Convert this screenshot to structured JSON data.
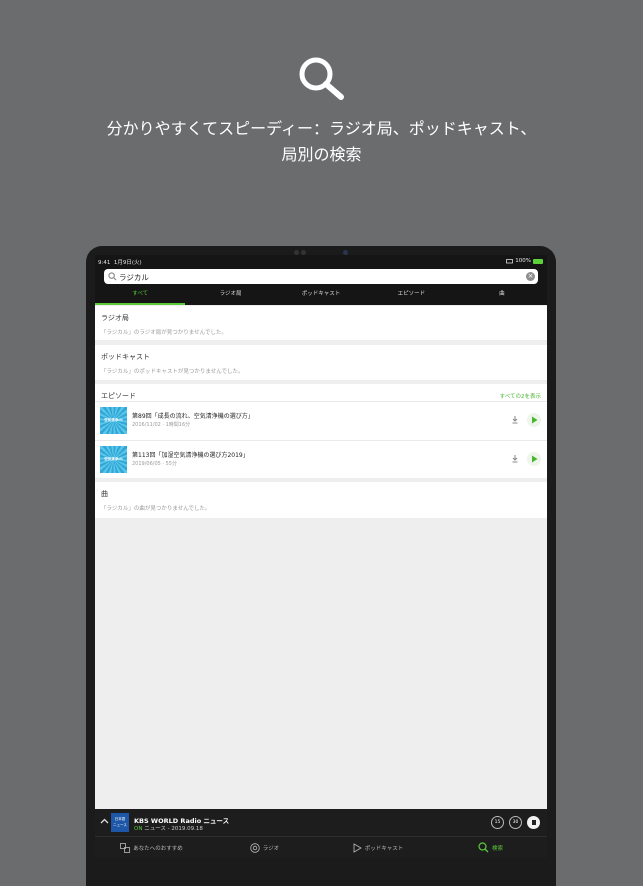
{
  "headline": {
    "line1": "分かりやすくてスピーディー：ラジオ局、ポッドキャスト、",
    "line2": "局別の検索"
  },
  "status": {
    "time": "9:41",
    "date": "1月9日(火)",
    "battery": "100%"
  },
  "search": {
    "value": "ラジカル"
  },
  "tabs": [
    "すべて",
    "ラジオ局",
    "ポッドキャスト",
    "エピソード",
    "曲"
  ],
  "sections": {
    "stations": {
      "title": "ラジオ局",
      "note": "「ラジカル」のラジオ局が見つかりませんでした。"
    },
    "podcasts": {
      "title": "ポッドキャスト",
      "note": "「ラジカル」のポッドキャストが見つかりませんでした。"
    },
    "episodes": {
      "title": "エピソード",
      "more": "すべての2を表示",
      "items": [
        {
          "title": "第89回「成長の流れ、空気清浄機の選び方」",
          "meta": "2016/11/02 · 1時間16分",
          "thumb": "空気清浄ch"
        },
        {
          "title": "第113回「加湿空気清浄機の選び方2019」",
          "meta": "2019/06/05 · 55分",
          "thumb": "空気清浄ch"
        }
      ]
    },
    "songs": {
      "title": "曲",
      "note": "「ラジカル」の曲が見つかりませんでした。"
    }
  },
  "player": {
    "art_line1": "日本語",
    "art_line2": "ニュース",
    "title": "KBS WORLD Radio ニュース",
    "live": "ON",
    "subtitle": "ニュース - 2019.09.18",
    "skip_back": "15",
    "skip_fwd": "30"
  },
  "nav": [
    "あなたへのおすすめ",
    "ラジオ",
    "ポッドキャスト",
    "検索"
  ],
  "colors": {
    "accent": "#5cc83c",
    "background": "#6b6c6e"
  }
}
